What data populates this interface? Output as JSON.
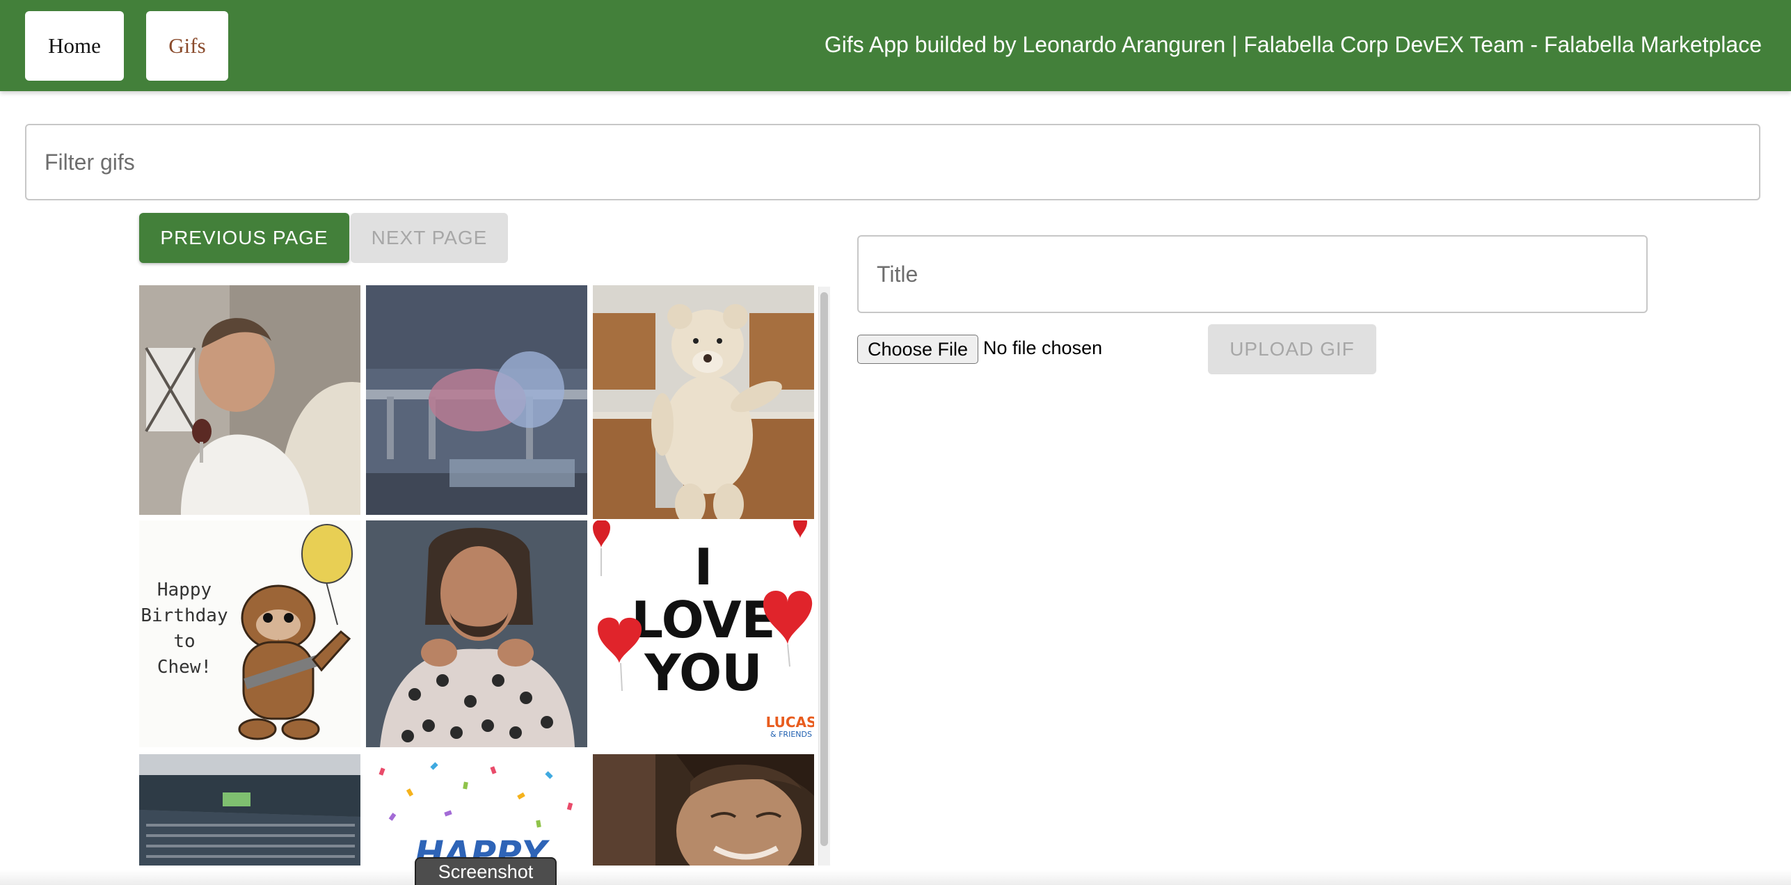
{
  "header": {
    "home_label": "Home",
    "gifs_label": "Gifs",
    "title": "Gifs App builded by Leonardo Aranguren | Falabella Corp DevEX Team - Falabella Marketplace",
    "background_color": "#43803a"
  },
  "filter": {
    "placeholder": "Filter gifs",
    "value": ""
  },
  "pagination": {
    "previous_label": "PREVIOUS PAGE",
    "next_label": "NEXT PAGE"
  },
  "gif_grid": {
    "items": [
      {
        "name": "man-laughing-wine-gif"
      },
      {
        "name": "blurry-dancing-gif"
      },
      {
        "name": "teddy-bear-dancing-gif"
      },
      {
        "name": "chewbacca-birthday-gif",
        "text_lines": [
          "Happy",
          "Birthday",
          "to",
          "Chew!"
        ]
      },
      {
        "name": "man-dotted-shirt-gif"
      },
      {
        "name": "i-love-you-gif",
        "text_lines": [
          "I",
          "LOVE",
          "YOU"
        ],
        "badge": "LUCAS",
        "badge_sub": "& FRIENDS"
      },
      {
        "name": "stadium-gif"
      },
      {
        "name": "happy-confetti-gif",
        "text": "HAPPY"
      },
      {
        "name": "man-smiling-gif"
      }
    ]
  },
  "upload_form": {
    "title_placeholder": "Title",
    "title_value": "",
    "choose_file_label": "Choose File",
    "file_status": "No file chosen",
    "upload_label": "UPLOAD GIF"
  },
  "overlay": {
    "tooltip": "Screenshot"
  }
}
